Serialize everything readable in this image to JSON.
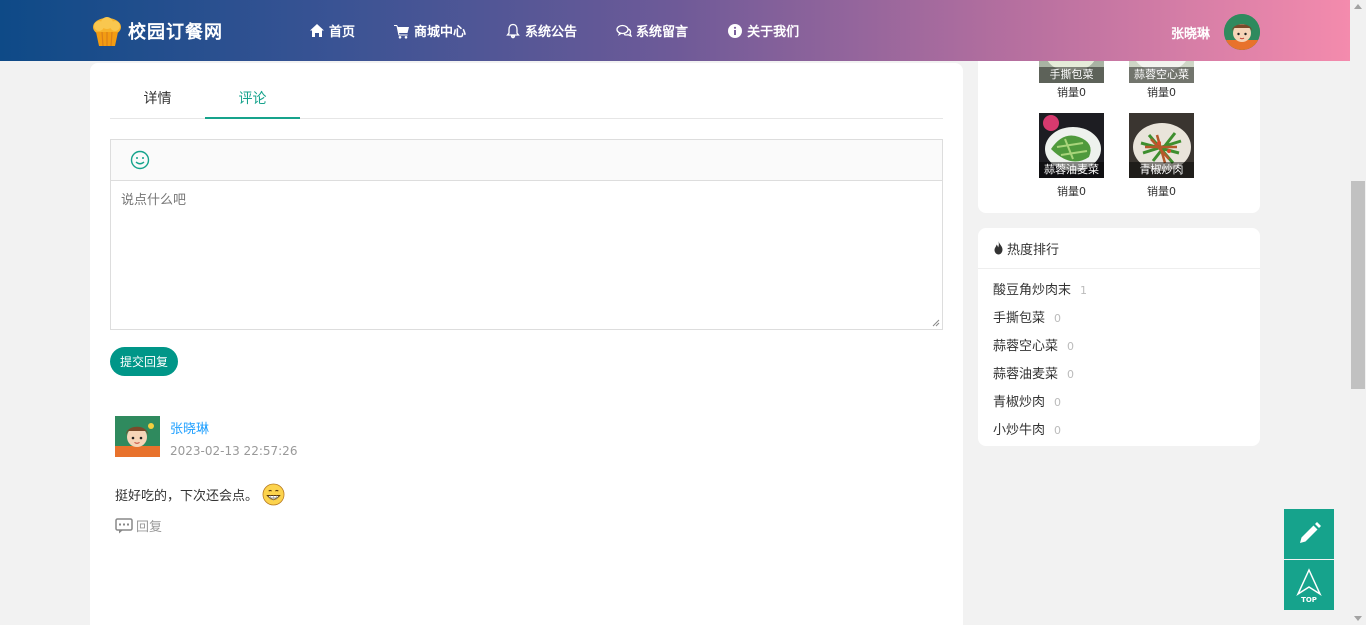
{
  "header": {
    "site_name": "校园订餐网",
    "nav": [
      {
        "label": "首页",
        "icon": "home-icon"
      },
      {
        "label": "商城中心",
        "icon": "cart-icon"
      },
      {
        "label": "系统公告",
        "icon": "bell-icon"
      },
      {
        "label": "系统留言",
        "icon": "chat-icon"
      },
      {
        "label": "关于我们",
        "icon": "info-icon"
      }
    ],
    "user_name": "张晓琳",
    "colors": {
      "gradient_start": "#0e4a87",
      "gradient_end": "#f48bad"
    }
  },
  "tabs": [
    {
      "label": "详情",
      "active": false
    },
    {
      "label": "评论",
      "active": true
    }
  ],
  "editor": {
    "placeholder": "说点什么吧",
    "value": "",
    "emoji_icon": "smile-icon",
    "submit_label": "提交回复"
  },
  "comments": [
    {
      "user": "张晓琳",
      "time": "2023-02-13 22:57:26",
      "text": "挺好吃的，下次还会点。",
      "emoji": "grin-emoji",
      "reply_label": "回复"
    }
  ],
  "related": [
    {
      "name": "手撕包菜",
      "sales": "销量0"
    },
    {
      "name": "蒜蓉空心菜",
      "sales": "销量0"
    },
    {
      "name": "蒜蓉油麦菜",
      "sales": "销量0"
    },
    {
      "name": "青椒炒肉",
      "sales": "销量0"
    }
  ],
  "hot": {
    "title": "热度排行",
    "items": [
      {
        "name": "酸豆角炒肉末",
        "count": "1"
      },
      {
        "name": "手撕包菜",
        "count": "0"
      },
      {
        "name": "蒜蓉空心菜",
        "count": "0"
      },
      {
        "name": "蒜蓉油麦菜",
        "count": "0"
      },
      {
        "name": "青椒炒肉",
        "count": "0"
      },
      {
        "name": "小炒牛肉",
        "count": "0"
      }
    ]
  },
  "float_buttons": {
    "edit_icon": "pencil-icon",
    "top_icon": "back-to-top-icon",
    "top_label": "TOP"
  },
  "accent_color": "#16a38c"
}
